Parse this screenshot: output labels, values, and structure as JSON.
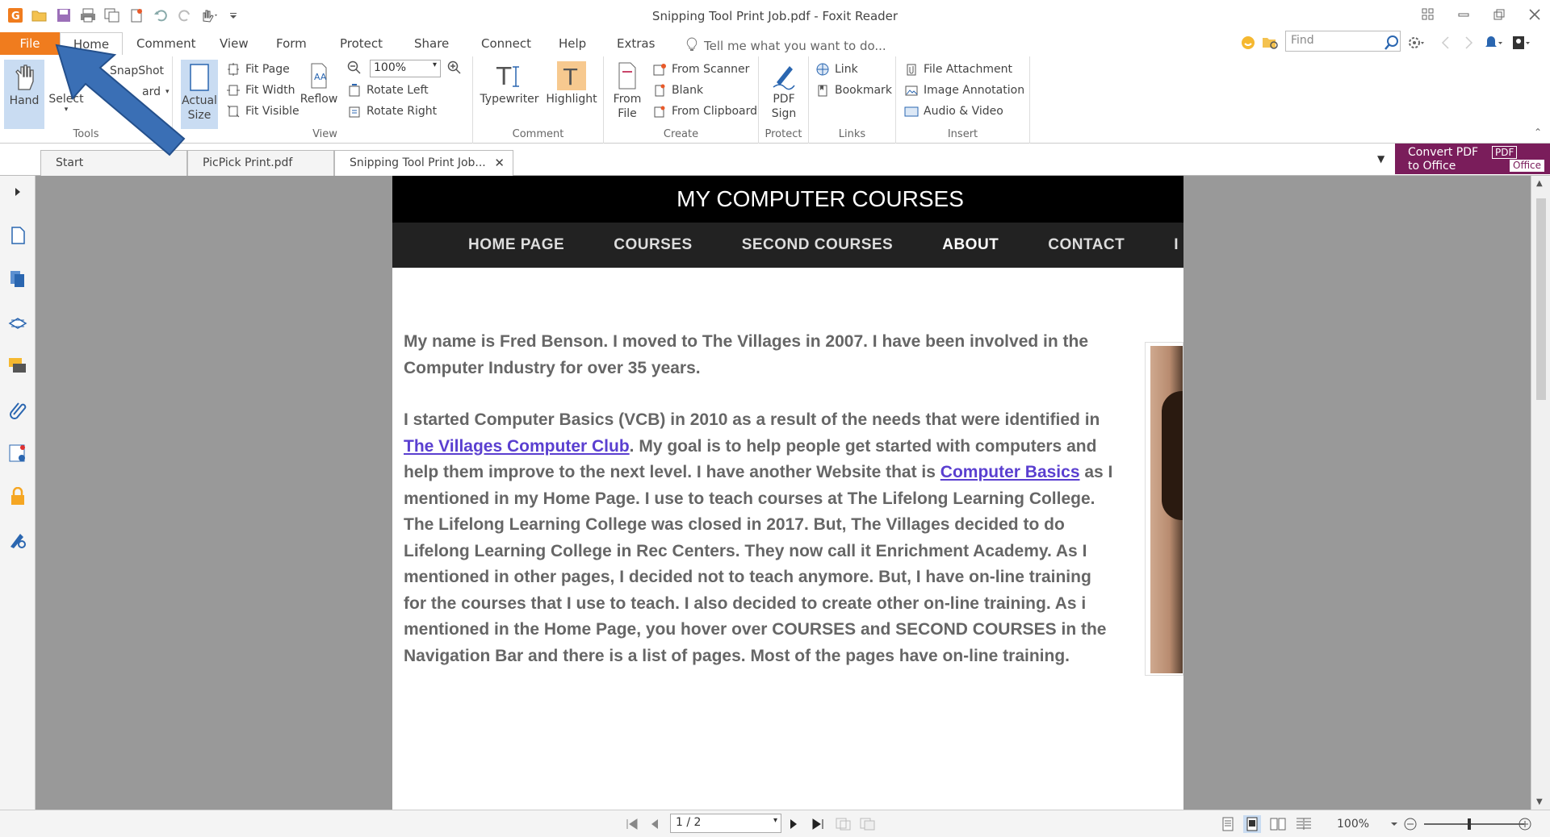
{
  "window": {
    "title": "Snipping Tool Print Job.pdf - Foxit Reader"
  },
  "menu_tabs": [
    "File",
    "Home",
    "Comment",
    "View",
    "Form",
    "Protect",
    "Share",
    "Connect",
    "Help",
    "Extras"
  ],
  "tell_me": "Tell me what you want to do...",
  "search": {
    "placeholder": "Find"
  },
  "ribbon": {
    "tools": {
      "label": "Tools",
      "hand": "Hand",
      "select": "Select",
      "snapshot": "SnapShot",
      "clipboard": "ard"
    },
    "view": {
      "label": "View",
      "actual_size": "Actual Size",
      "fit_page": "Fit Page",
      "fit_width": "Fit Width",
      "fit_visible": "Fit Visible",
      "reflow": "Reflow",
      "zoom": "100%",
      "rotate_left": "Rotate Left",
      "rotate_right": "Rotate Right"
    },
    "comment": {
      "label": "Comment",
      "typewriter": "Typewriter",
      "highlight": "Highlight"
    },
    "create": {
      "label": "Create",
      "from_file": "From File",
      "from_scanner": "From Scanner",
      "blank": "Blank",
      "from_clipboard": "From Clipboard"
    },
    "protect": {
      "label": "Protect",
      "pdf_sign": "PDF Sign"
    },
    "links": {
      "label": "Links",
      "link": "Link",
      "bookmark": "Bookmark"
    },
    "insert": {
      "label": "Insert",
      "file_attachment": "File Attachment",
      "image_annotation": "Image Annotation",
      "audio_video": "Audio & Video"
    }
  },
  "doc_tabs": [
    {
      "label": "Start"
    },
    {
      "label": "PicPick Print.pdf"
    },
    {
      "label": "Snipping Tool Print Job..."
    }
  ],
  "convert": {
    "line1": "Convert PDF",
    "line2": "to Office",
    "badge1": "PDF",
    "badge2": "Office"
  },
  "document": {
    "site_title": "MY COMPUTER COURSES",
    "nav": [
      "HOME PAGE",
      "COURSES",
      "SECOND COURSES",
      "ABOUT",
      "CONTACT",
      "I"
    ],
    "para1": "My name is Fred Benson.  I moved to The Villages in 2007.  I have been involved in the Computer Industry for over 35 years.",
    "para2_a": "I started Computer Basics (VCB) in 2010 as a result of the needs that were identified in ",
    "link1": "The Villages Computer Club",
    "para2_b": ".  My goal is to help people get started with computers and help them improve to the next level.  I have another Website that is ",
    "link2": "Computer Basics",
    "para2_c": " as I mentioned in my Home Page.  I use to teach courses at The Lifelong Learning College.  The Lifelong Learning College was closed in 2017.  But, The Villages decided to do Lifelong Learning College in Rec Centers.  They now call it Enrichment Academy.  As I mentioned in other pages, I decided not to teach anymore.  But, I have on-line training for the courses that I use to teach.  I also decided to create other on-line training.  As i mentioned in the Home Page, you hover over COURSES and SECOND COURSES in the Navigation Bar and there is a list of pages.  Most of the pages have on-line training."
  },
  "status": {
    "page": "1 / 2",
    "zoom": "100%",
    "zoom_level_fraction": 0.45
  },
  "colors": {
    "file_tab": "#f07c1e",
    "convert_bg": "#7a1d5b",
    "arrow": "#3a6fb5",
    "link": "#5a3fd0"
  }
}
